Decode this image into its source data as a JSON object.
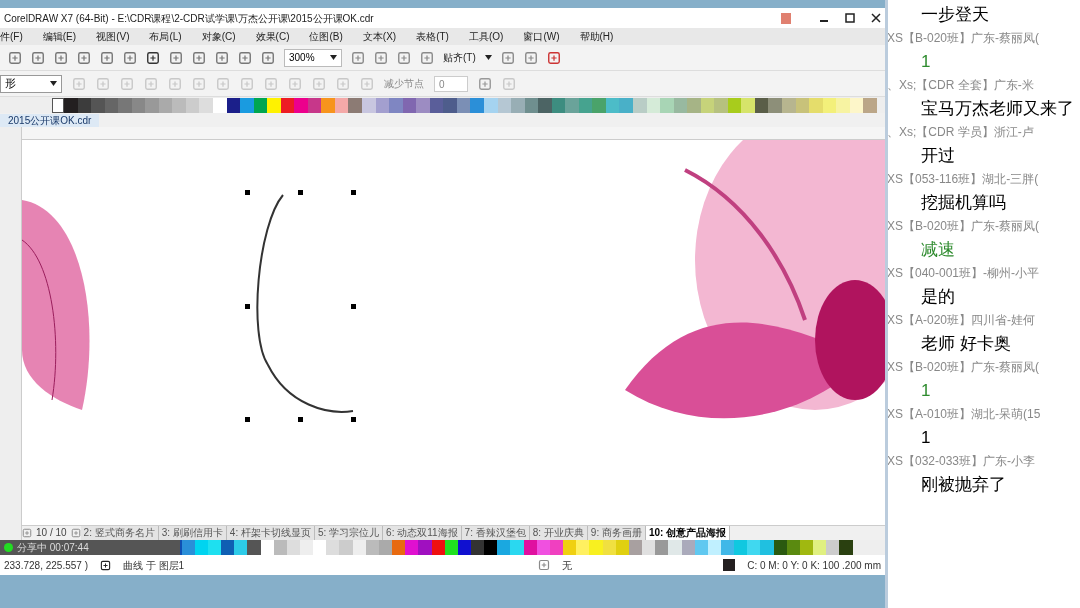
{
  "window": {
    "title": "CorelDRAW X7 (64-Bit) - E:\\CDR课程\\2-CDR试学课\\万杰公开课\\2015公开课OK.cdr"
  },
  "menu": [
    "件(F)",
    "编辑(E)",
    "视图(V)",
    "布局(L)",
    "对象(C)",
    "效果(C)",
    "位图(B)",
    "文本(X)",
    "表格(T)",
    "工具(O)",
    "窗口(W)",
    "帮助(H)"
  ],
  "toolbar": {
    "zoom": "300%",
    "snap": "贴齐(T)"
  },
  "property_bar": {
    "shape_select": "形",
    "reduce_nodes": "减少节点",
    "smoothness": "0"
  },
  "document_tab": "2015公开课OK.cdr",
  "page_nav": {
    "counter": "10 / 10",
    "pages": [
      {
        "label": "2: 竖式商务名片",
        "selected": false
      },
      {
        "label": "3: 刷刷信用卡",
        "selected": false
      },
      {
        "label": "4: 杆架卡切线显页",
        "selected": false
      },
      {
        "label": "5: 学习宗位儿",
        "selected": false
      },
      {
        "label": "6: 动态双11海报",
        "selected": false
      },
      {
        "label": "7: 香辣汉堡包",
        "selected": false
      },
      {
        "label": "8: 开业庆典",
        "selected": false
      },
      {
        "label": "9: 商务画册",
        "selected": false
      },
      {
        "label": "10: 创意产品海报",
        "selected": true
      }
    ]
  },
  "sharing": "分享中 00:07:44",
  "status_bar": {
    "coords": "233.728, 225.557 )",
    "object": "曲线 于 图层1",
    "fill": "无",
    "outline": "C: 0 M: 0 Y: 0 K: 100  .200 mm"
  },
  "chat": [
    {
      "text": "一步登天",
      "color": "#000000"
    },
    {
      "sender": "XS【B-020班】广东-蔡丽凤(",
      "text": "1",
      "color": "#2e8b2e"
    },
    {
      "sender": "、Xs;【CDR 全套】广东-米",
      "text": "宝马万杰老师又来了",
      "color": "#000000"
    },
    {
      "sender": "、Xs;【CDR 学员】浙江-卢",
      "text": "开过",
      "color": "#000000"
    },
    {
      "sender": "XS【053-116班】湖北-三胖(",
      "text": "挖掘机算吗",
      "color": "#000000"
    },
    {
      "sender": "XS【B-020班】广东-蔡丽凤(",
      "text": "减速",
      "color": "#2e8b2e"
    },
    {
      "sender": "XS【040-001班】-柳州-小平",
      "text": "是的",
      "color": "#000000"
    },
    {
      "sender": "XS【A-020班】四川省-娃何",
      "text": "老师  好卡奥",
      "color": "#000000"
    },
    {
      "sender": "XS【B-020班】广东-蔡丽凤(",
      "text": "1",
      "color": "#2e8b2e"
    },
    {
      "sender": "XS【A-010班】湖北-呆萌(15",
      "text": "1",
      "color": "#000000"
    },
    {
      "sender": "XS【032-033班】广东-小李",
      "text": "刚被抛弃了",
      "color": "#000000"
    }
  ]
}
